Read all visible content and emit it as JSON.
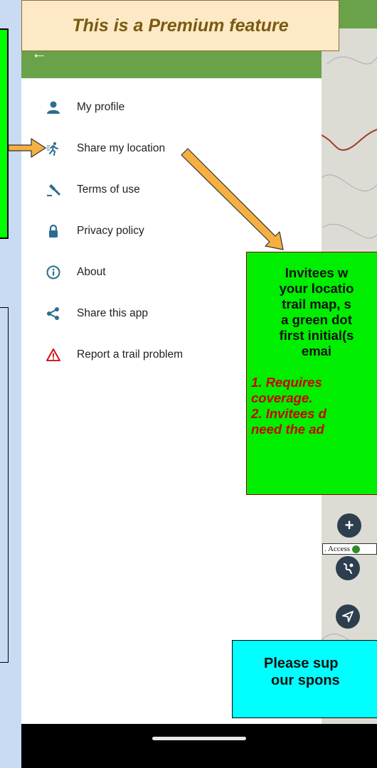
{
  "banner": {
    "text": "This is a Premium feature"
  },
  "drawer": {
    "back_icon": "arrow-left-icon",
    "items": [
      {
        "label": "My profile",
        "icon": "person-icon"
      },
      {
        "label": "Share my location",
        "icon": "running-person-icon"
      },
      {
        "label": "Terms of use",
        "icon": "gavel-icon"
      },
      {
        "label": "Privacy policy",
        "icon": "lock-icon"
      },
      {
        "label": "About",
        "icon": "info-icon"
      },
      {
        "label": "Share this app",
        "icon": "share-icon"
      },
      {
        "label": "Report a trail problem",
        "icon": "warning-icon"
      }
    ]
  },
  "callout_green": {
    "lines": [
      "Invitees w",
      "your locatio",
      "trail map, s",
      "a green dot",
      "first initial(s",
      "emai"
    ],
    "notes": [
      "1. Requires",
      "coverage.",
      "2. Invitees d",
      "need the ad"
    ]
  },
  "callout_cyan": {
    "lines": [
      "Please sup",
      "our spons"
    ]
  },
  "map": {
    "access_label": ". Access"
  },
  "colors": {
    "header_green": "#6aa24a",
    "callout_green": "#00ee00",
    "callout_cyan": "#00ffff",
    "banner_bg": "#fde9c6",
    "icon_blue": "#2b6d8f",
    "warning_red": "#cc0000"
  }
}
